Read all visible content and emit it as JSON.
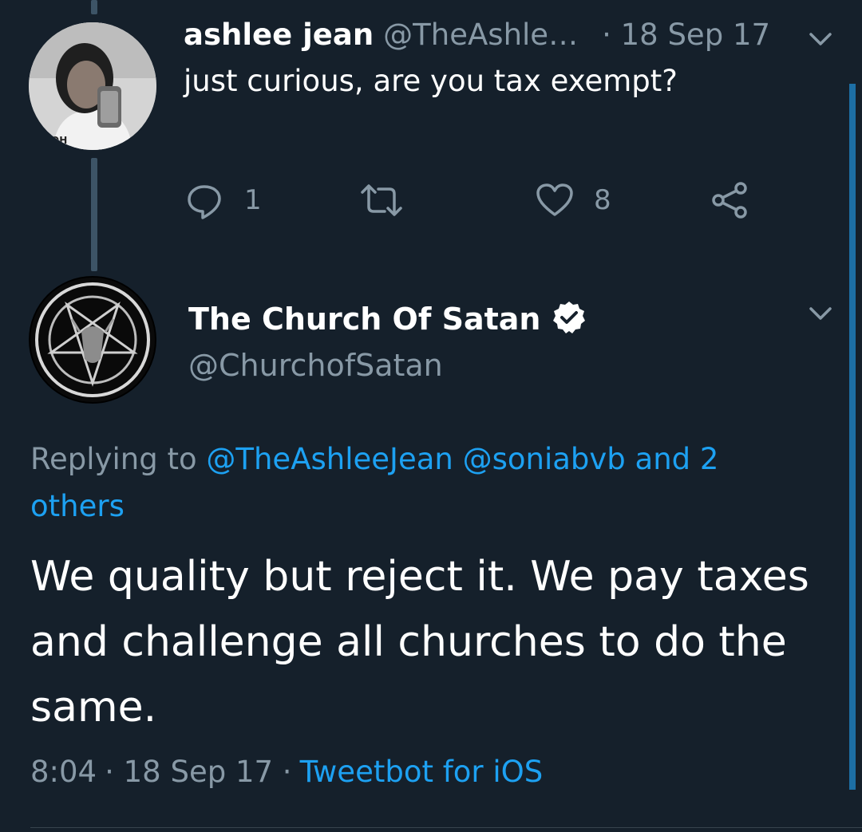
{
  "parent_tweet": {
    "author_name": "ashlee jean",
    "author_handle": "@TheAshle…",
    "date": "· 18 Sep 17",
    "text": "just curious, are you tax exempt?",
    "actions": {
      "reply_count": "1",
      "retweet_count": "",
      "like_count": "8"
    },
    "avatar_shirt_text": "OH"
  },
  "main_tweet": {
    "author_name": "The Church Of Satan",
    "author_handle": "@ChurchofSatan",
    "replying_prefix": "Replying to",
    "replying_users": "@TheAshleeJean @soniabvb and 2",
    "replying_others": "others",
    "text": "We quality but reject it. We pay taxes and challenge all churches to do the same.",
    "time": "8:04",
    "date": "· 18 Sep 17 ·",
    "source": "Tweetbot for iOS"
  },
  "colors": {
    "background": "#15202b",
    "accent": "#1da1f2",
    "muted": "#8899a6",
    "thread_line": "#3d5466"
  },
  "icons": [
    "chevron-down-icon",
    "reply-icon",
    "retweet-icon",
    "like-icon",
    "share-icon",
    "verified-icon"
  ]
}
